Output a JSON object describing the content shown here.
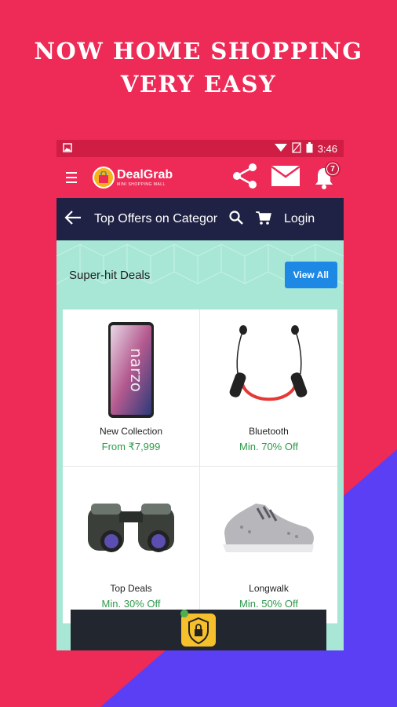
{
  "headline": {
    "line1": "NOW HOME SHOPPING",
    "line2": "VERY EASY"
  },
  "colors": {
    "background": "#ee2a56",
    "accent_diagonal": "#5b3ff5",
    "status_bar": "#d01d44",
    "app_bar": "#ee2a56",
    "nav_bar": "#1f2244",
    "content_bg": "#a8e7d6",
    "view_all": "#1e88e5",
    "offer_green": "#2e9a4a"
  },
  "status_bar": {
    "time": "3:46",
    "icons": [
      "image-icon",
      "wifi-icon",
      "no-sim-icon",
      "battery-icon"
    ]
  },
  "app_bar": {
    "logo_title": "DealGrab",
    "logo_subtitle": "MINI SHOPPING MALL",
    "notification_count": "7",
    "icons": [
      "menu-icon",
      "share-icon",
      "mail-icon",
      "bell-icon"
    ]
  },
  "nav_bar": {
    "title": "Top Offers on Categor",
    "login": "Login",
    "icons": [
      "back-arrow-icon",
      "search-icon",
      "cart-icon"
    ]
  },
  "section": {
    "title": "Super-hit Deals",
    "view_all": "View All"
  },
  "products": [
    {
      "name": "New Collection",
      "offer": "From ₹7,999",
      "icon": "smartphone-image"
    },
    {
      "name": "Bluetooth",
      "offer": "Min. 70% Off",
      "icon": "neckband-earphones-image"
    },
    {
      "name": "Top Deals",
      "offer": "Min. 30% Off",
      "icon": "binoculars-image"
    },
    {
      "name": "Longwalk",
      "offer": "Min. 50% Off",
      "icon": "sneaker-image"
    }
  ],
  "bottom_bar": {
    "icon": "shield-lock-icon"
  }
}
